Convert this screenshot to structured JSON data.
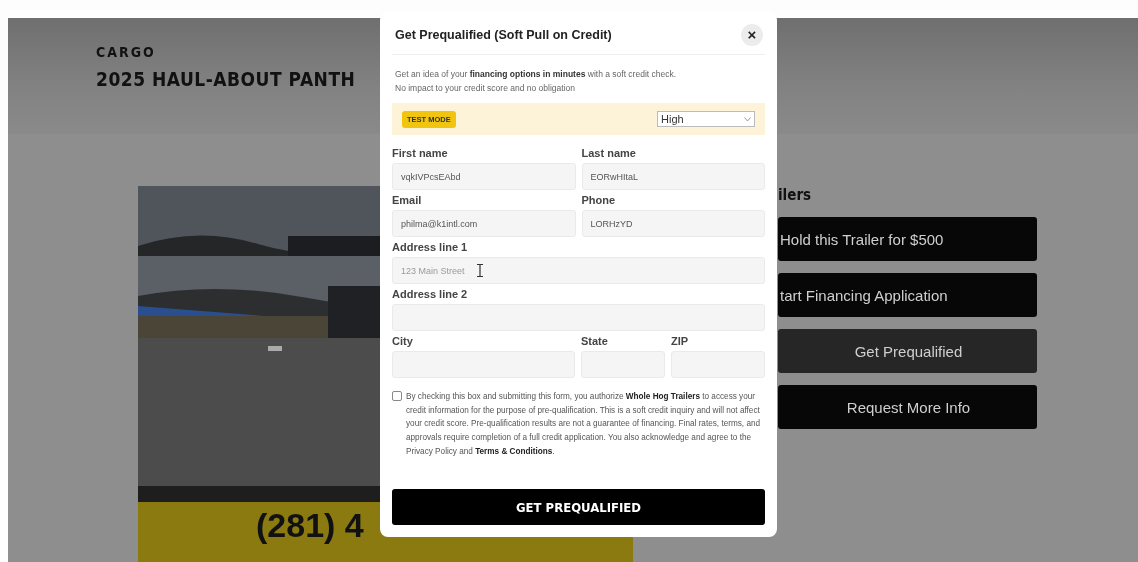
{
  "page": {
    "category": "CARGO",
    "title": "2025 HAUL-ABOUT PANTH",
    "phone": "(281) 4",
    "side_heading": "ilers",
    "actions": [
      {
        "label": "Hold this Trailer for $500",
        "highlighted": false
      },
      {
        "label": "tart Financing Application",
        "highlighted": false
      },
      {
        "label": "Get Prequalified",
        "highlighted": true
      },
      {
        "label": "Request More Info",
        "highlighted": false
      }
    ]
  },
  "modal": {
    "title": "Get Prequalified (Soft Pull on Credit)",
    "close": "×",
    "intro": [
      "Get an idea of your **financing options in minutes** with a soft credit check.",
      "No impact to your credit score and no obligation"
    ],
    "test_mode": {
      "badge": "TEST MODE",
      "select": "High"
    },
    "rows": [
      [
        {
          "label": "First name",
          "value": "vqkIVPcsEAbd"
        },
        {
          "label": "Last name",
          "value": "EORwHItaL"
        }
      ],
      [
        {
          "label": "Email",
          "value": "philma@k1intl.com"
        },
        {
          "label": "Phone",
          "value": "LORHzYD"
        }
      ],
      [
        {
          "label": "Address line 1",
          "placeholder": "123 Main Street",
          "cursor": true
        }
      ],
      [
        {
          "label": "Address line 2"
        }
      ],
      [
        {
          "label": "City"
        },
        {
          "label": "State"
        },
        {
          "label": "ZIP"
        }
      ]
    ],
    "consent": {
      "checked": false,
      "text": "By checking this box and submitting this form, you authorize **Whole Hog Trailers** to access your credit information for the purpose of pre-qualification. This is a soft credit inquiry and will not affect your credit score. Pre-qualification results are not a guarantee of financing. Final rates, terms, and approvals require completion of a full credit application. You also acknowledge and agree to the Privacy Policy and **Terms & Conditions**."
    },
    "submit": "GET PREQUALIFIED"
  }
}
